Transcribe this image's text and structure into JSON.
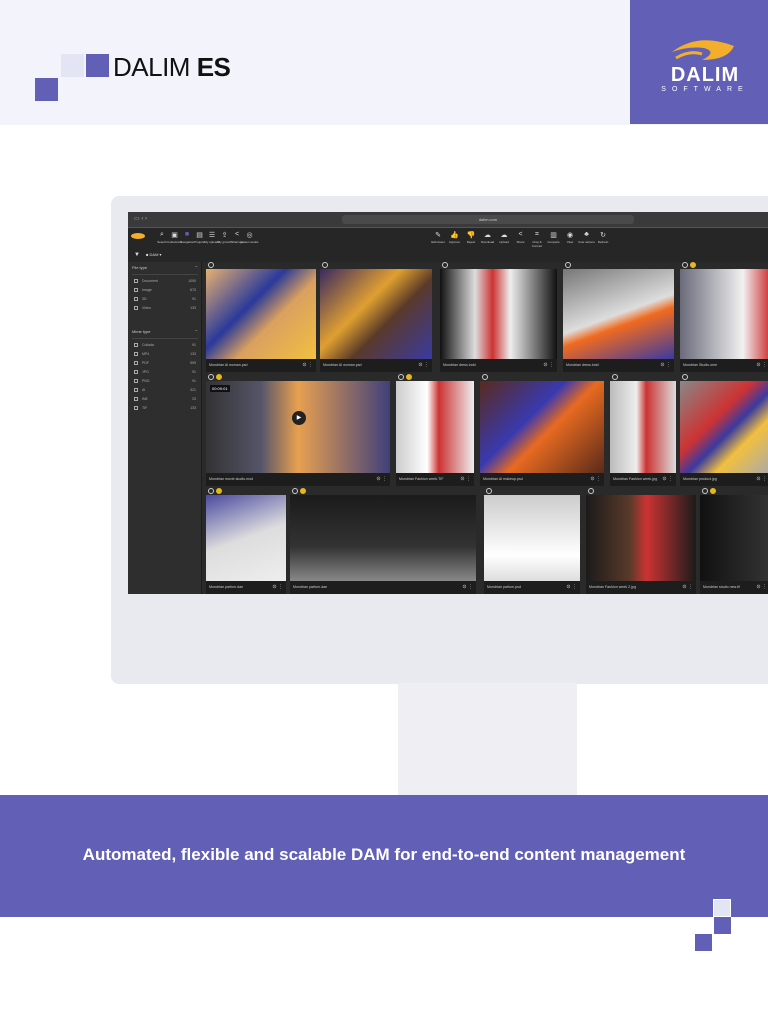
{
  "brand": {
    "product": "DALIM",
    "product_suffix": "ES",
    "logo_text": "DALIM",
    "logo_sub": "SOFTWARE"
  },
  "browser": {
    "url": "dalim.com"
  },
  "app": {
    "nav": [
      "Search",
      "Collections",
      "Navigation",
      "Projects",
      "My uploads",
      "My growth",
      "Sharings",
      "Latest results"
    ],
    "toolbar": [
      "Edit Asset",
      "Approve",
      "Reject",
      "Download",
      "Upload",
      "Share",
      "Crop & Convert",
      "Compare",
      "View",
      "User actions",
      "Refresh"
    ],
    "folder": "DAM",
    "filter_label": "Filter"
  },
  "sidebar": {
    "sections": [
      {
        "title": "File type",
        "items": [
          {
            "label": "Document",
            "count": "1090"
          },
          {
            "label": "Image",
            "count": "673"
          },
          {
            "label": "3D",
            "count": "91"
          },
          {
            "label": "Video",
            "count": "133"
          }
        ]
      },
      {
        "title": "Mime type",
        "items": [
          {
            "label": "Collada",
            "count": "91"
          },
          {
            "label": "MP4",
            "count": "133"
          },
          {
            "label": "PDF",
            "count": "599"
          },
          {
            "label": "JPG",
            "count": "91"
          },
          {
            "label": "PNG",
            "count": "91"
          },
          {
            "label": "AI",
            "count": "321"
          },
          {
            "label": "INE",
            "count": "23"
          },
          {
            "label": "TIF",
            "count": "133"
          }
        ]
      }
    ]
  },
  "assets": [
    {
      "name": "Mondrian AI woman.psd"
    },
    {
      "name": "Mondrian AI woman.psd"
    },
    {
      "name": "Mondrian dress.indd"
    },
    {
      "name": "Mondrian dress.indd"
    },
    {
      "name": "Mondrian Studio.ome"
    },
    {
      "name": "Mondrian movie studio.mod",
      "duration": "00:09:01"
    },
    {
      "name": "Mondrian Fashion week.TIF"
    },
    {
      "name": "Mondrian AI makeup.psd"
    },
    {
      "name": "Mondrian Fashion week.jpg"
    },
    {
      "name": "Mondrian product.jpg"
    },
    {
      "name": "Mondrian parfum.dae"
    },
    {
      "name": "Mondrian parfum.dae"
    },
    {
      "name": "Mondrian parfum.psd"
    },
    {
      "name": "Mondrian Fashion week 2.jpg"
    },
    {
      "name": "Mondrian studio new.tif"
    }
  ],
  "tagline": "Automated, flexible and scalable DAM for end-to-end content management",
  "colors": {
    "brand_purple": "#625fb7",
    "light": "#e3e5f4",
    "logo_orange": "#f3ae2b"
  }
}
